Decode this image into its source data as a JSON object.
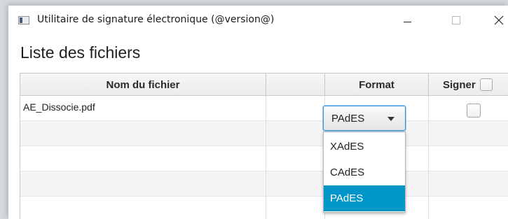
{
  "window": {
    "title": "Utilitaire de signature électronique (@version@)",
    "icons": {
      "app": "app-icon",
      "minimize": "minimize-icon",
      "maximize": "maximize-icon",
      "close": "close-icon"
    }
  },
  "page": {
    "heading": "Liste des fichiers"
  },
  "table": {
    "columns": {
      "name": "Nom du fichier",
      "blank": "",
      "format": "Format",
      "sign": "Signer"
    },
    "rows": [
      {
        "file": "AE_Dissocie.pdf",
        "format": "PAdES",
        "signed": false
      }
    ]
  },
  "format_combo": {
    "value": "PAdES",
    "options": [
      "XAdES",
      "CAdES",
      "PAdES"
    ],
    "selected_index": 2,
    "selection_color": "#0096c9"
  }
}
